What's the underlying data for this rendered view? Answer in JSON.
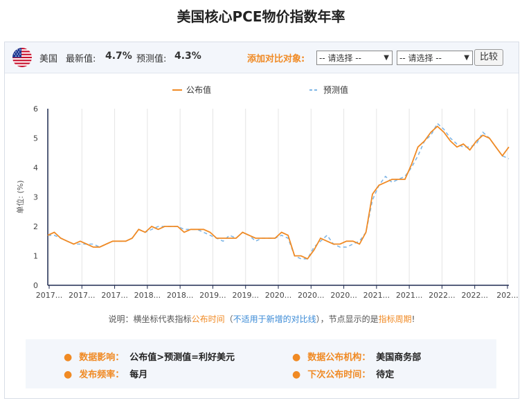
{
  "page": {
    "title": "美国核心PCE物价指数年率"
  },
  "topbar": {
    "country": "美国",
    "latest_label": "最新值:",
    "latest_value": "4.7%",
    "forecast_label": "预测值:",
    "forecast_value": "4.3%",
    "compare_label": "添加对比对象:",
    "select1": "-- 请选择 --",
    "select2": "-- 请选择 --",
    "compare_button": "比较"
  },
  "note": {
    "p1": "说明：横坐标代表指标",
    "p2": "公布时间",
    "p3": "（",
    "p4": "不适用于新增的对比线",
    "p5": "），节点显示的是",
    "p6": "指标周期",
    "p7": "!"
  },
  "info": {
    "impact_label": "数据影响：",
    "impact_value": "公布值>预测值=利好美元",
    "agency_label": "数据公布机构：",
    "agency_value": "美国商务部",
    "freq_label": "发布频率：",
    "freq_value": "每月",
    "next_label": "下次公布时间：",
    "next_value": "待定"
  },
  "colors": {
    "actual": "#f08a24",
    "forecast": "#7fb6e6",
    "accent": "#f08a24"
  },
  "chart_data": {
    "type": "line",
    "ylabel": "单位: (%)",
    "ylim": [
      0,
      6
    ],
    "yticks": [
      0,
      1,
      2,
      3,
      4,
      5,
      6
    ],
    "xtick_labels": [
      "2017...",
      "2017...",
      "2017...",
      "2018...",
      "2018...",
      "2019...",
      "2019...",
      "2020...",
      "2020...",
      "2020...",
      "2021...",
      "2021...",
      "2022...",
      "2022...",
      "202..."
    ],
    "legend": [
      "公布值",
      "预测值"
    ],
    "legend_position": "top",
    "grid": "vertical",
    "series": [
      {
        "name": "公布值",
        "style": "solid",
        "values": [
          1.7,
          1.8,
          1.6,
          1.5,
          1.4,
          1.5,
          1.4,
          1.3,
          1.3,
          1.4,
          1.5,
          1.5,
          1.5,
          1.6,
          1.9,
          1.8,
          2.0,
          1.9,
          2.0,
          2.0,
          2.0,
          1.8,
          1.9,
          1.9,
          1.9,
          1.8,
          1.6,
          1.6,
          1.6,
          1.6,
          1.8,
          1.7,
          1.6,
          1.6,
          1.6,
          1.6,
          1.8,
          1.7,
          1.0,
          1.0,
          0.9,
          1.2,
          1.6,
          1.5,
          1.4,
          1.4,
          1.5,
          1.5,
          1.4,
          1.8,
          3.1,
          3.4,
          3.5,
          3.6,
          3.6,
          3.6,
          4.1,
          4.7,
          4.9,
          5.2,
          5.4,
          5.2,
          4.9,
          4.7,
          4.8,
          4.6,
          4.9,
          5.1,
          5.0,
          4.7,
          4.4,
          4.7
        ]
      },
      {
        "name": "预测值",
        "style": "dashed",
        "values": [
          1.7,
          1.7,
          1.6,
          1.5,
          1.4,
          1.4,
          1.4,
          1.4,
          1.3,
          1.4,
          1.5,
          1.5,
          1.5,
          1.6,
          1.9,
          1.8,
          1.9,
          2.0,
          2.0,
          2.0,
          2.0,
          1.9,
          1.9,
          1.9,
          1.8,
          1.7,
          1.6,
          1.5,
          1.7,
          1.6,
          1.8,
          1.7,
          1.5,
          1.6,
          1.6,
          1.6,
          1.7,
          1.6,
          1.0,
          0.9,
          0.9,
          1.3,
          1.5,
          1.7,
          1.4,
          1.3,
          1.3,
          1.4,
          1.5,
          1.8,
          2.9,
          3.4,
          3.7,
          3.5,
          3.6,
          3.7,
          4.0,
          4.4,
          4.9,
          5.1,
          5.5,
          5.3,
          5.0,
          4.8,
          4.7,
          4.7,
          4.8,
          5.2,
          5.0,
          4.7,
          4.4,
          4.3
        ]
      }
    ]
  }
}
